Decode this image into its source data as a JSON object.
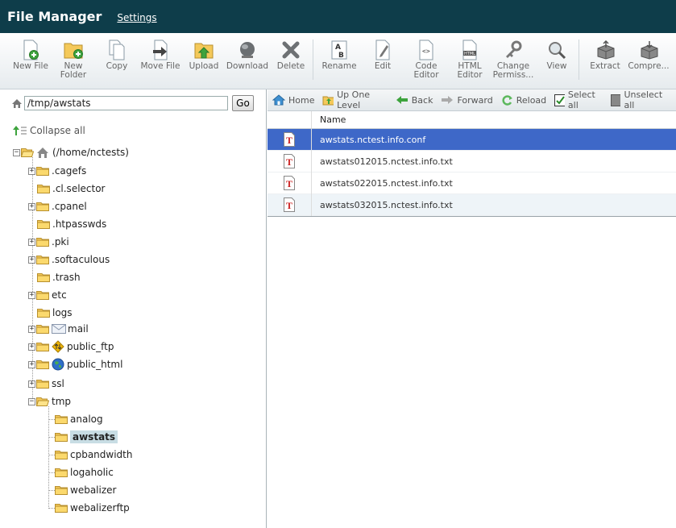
{
  "header": {
    "title": "File Manager",
    "settings": "Settings"
  },
  "toolbar": {
    "items": [
      {
        "label": "New File",
        "icon": "new-file-icon"
      },
      {
        "label": "New Folder",
        "icon": "new-folder-icon"
      },
      {
        "label": "Copy",
        "icon": "copy-icon"
      },
      {
        "label": "Move File",
        "icon": "move-file-icon"
      },
      {
        "label": "Upload",
        "icon": "upload-icon"
      },
      {
        "label": "Download",
        "icon": "download-icon"
      },
      {
        "label": "Delete",
        "icon": "delete-icon"
      },
      {
        "label": "Rename",
        "icon": "rename-icon"
      },
      {
        "label": "Edit",
        "icon": "edit-icon"
      },
      {
        "label": "Code Editor",
        "icon": "code-editor-icon"
      },
      {
        "label": "HTML Editor",
        "icon": "html-editor-icon"
      },
      {
        "label": "Change Permiss...",
        "icon": "permissions-icon"
      },
      {
        "label": "View",
        "icon": "view-icon"
      },
      {
        "label": "Extract",
        "icon": "extract-icon"
      },
      {
        "label": "Compre...",
        "icon": "compress-icon"
      }
    ]
  },
  "pathbar": {
    "value": "/tmp/awstats",
    "go": "Go"
  },
  "tree": {
    "collapse_label": "Collapse all",
    "root": "(/home/nctests)",
    "nodes": [
      ".cagefs",
      ".cl.selector",
      ".cpanel",
      ".htpasswds",
      ".pki",
      ".softaculous",
      ".trash",
      "etc",
      "logs",
      "mail",
      "public_ftp",
      "public_html",
      "ssl",
      "tmp"
    ],
    "tmp_children": [
      "analog",
      "awstats",
      "cpbandwidth",
      "logaholic",
      "webalizer",
      "webalizerftp"
    ]
  },
  "nav": {
    "home": "Home",
    "up": "Up One Level",
    "back": "Back",
    "forward": "Forward",
    "reload": "Reload",
    "select_all": "Select all",
    "unselect_all": "Unselect all"
  },
  "table": {
    "header": "Name",
    "rows": [
      "awstats.nctest.info.conf",
      "awstats012015.nctest.info.txt",
      "awstats022015.nctest.info.txt",
      "awstats032015.nctest.info.txt"
    ]
  }
}
